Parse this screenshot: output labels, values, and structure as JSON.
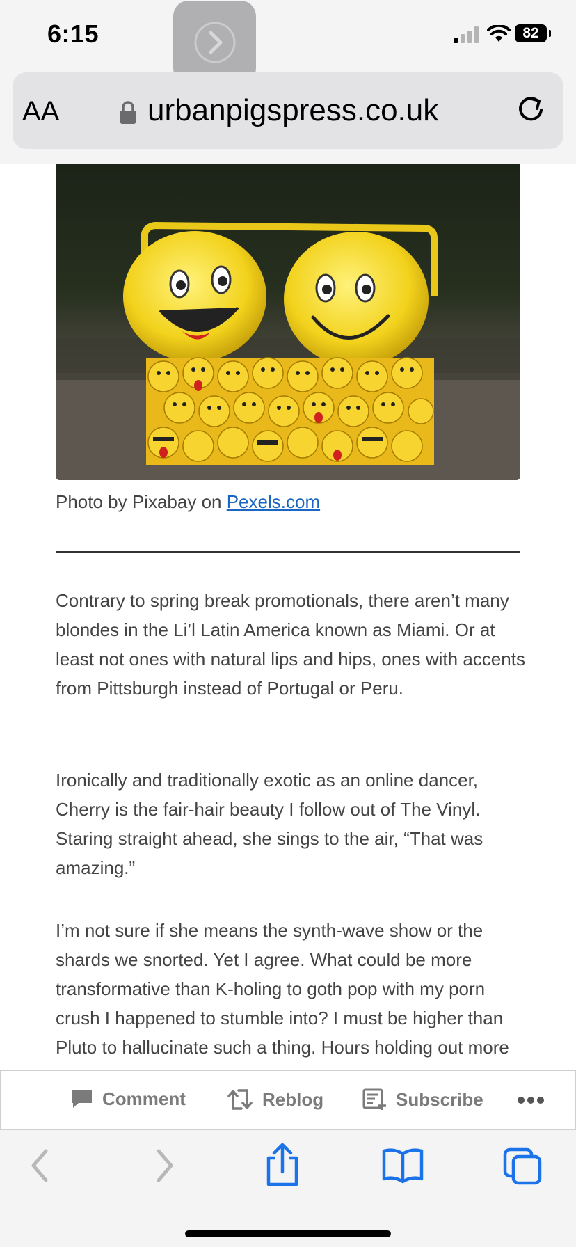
{
  "status_bar": {
    "time": "6:15",
    "battery": "82"
  },
  "address_bar": {
    "text_size_label": "AA",
    "url": "urbanpigspress.co.uk"
  },
  "article": {
    "photo_alt": "Two yellow smiley plush toys in an emoji-printed box",
    "caption_prefix": "Photo by Pixabay on ",
    "caption_link": "Pexels.com",
    "paragraphs": [
      "Contrary to spring break promotionals, there aren’t many blondes in the Li’l Latin America known as Miami. Or at least not ones with natural lips and hips, ones with accents from Pittsburgh instead of Portugal or Peru.",
      "Ironically and traditionally exotic as an online dancer, Cherry is the fair-hair beauty I follow out of The Vinyl. Staring straight ahead, she sings to the air, “That was amazing.”",
      "I’m not sure if she means the synth-wave show or the shards we snorted. Yet I agree. What could be more transformative than K-holing to goth pop with my porn crush I happened to stumble into? I must be higher than Pluto to hallucinate such a thing. Hours holding out more than I ever got, fearing"
    ]
  },
  "action_bar": {
    "comment": "Comment",
    "reblog": "Reblog",
    "subscribe": "Subscribe"
  },
  "colors": {
    "link": "#1a66c2",
    "safari_blue": "#1a73e8",
    "bar_bg": "#f4f4f5"
  }
}
